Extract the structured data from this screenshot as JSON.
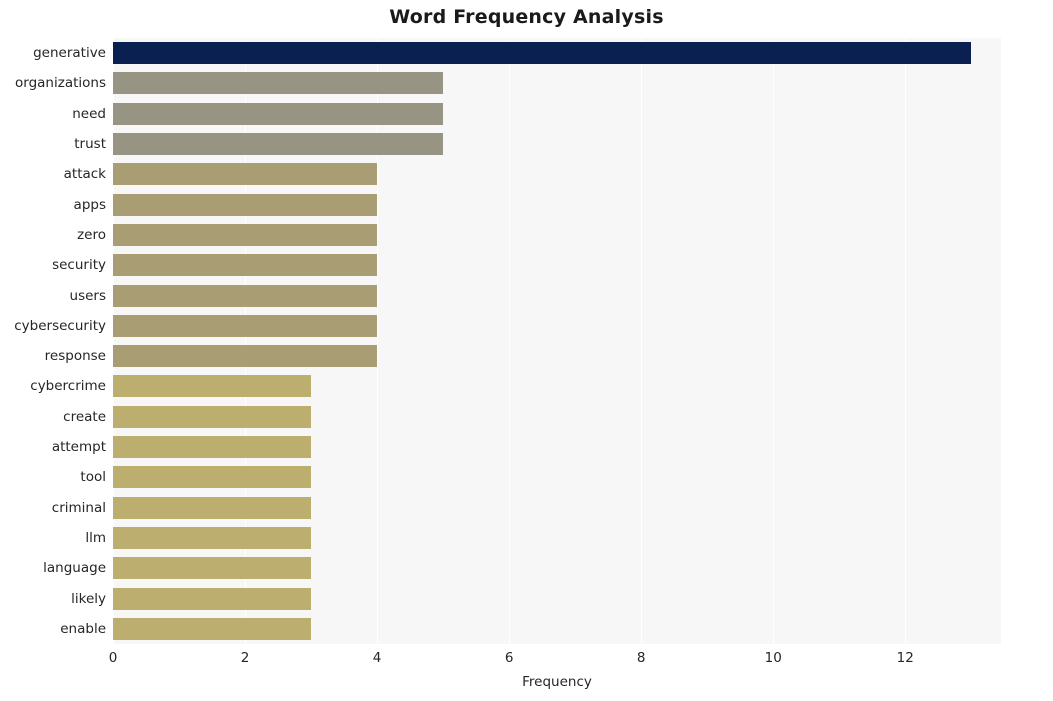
{
  "chart_data": {
    "type": "bar",
    "orientation": "horizontal",
    "title": "Word Frequency Analysis",
    "xlabel": "Frequency",
    "ylabel": "",
    "xlim": [
      0,
      13.45
    ],
    "xticks": [
      0,
      2,
      4,
      6,
      8,
      10,
      12
    ],
    "grid": true,
    "legend": null,
    "categories": [
      "generative",
      "organizations",
      "need",
      "trust",
      "attack",
      "apps",
      "zero",
      "security",
      "users",
      "cybersecurity",
      "response",
      "cybercrime",
      "create",
      "attempt",
      "tool",
      "criminal",
      "llm",
      "language",
      "likely",
      "enable"
    ],
    "values": [
      13,
      5,
      5,
      5,
      4,
      4,
      4,
      4,
      4,
      4,
      4,
      3,
      3,
      3,
      3,
      3,
      3,
      3,
      3,
      3
    ],
    "bar_colors": [
      "#0a2050",
      "#989483",
      "#989483",
      "#989483",
      "#a89d73",
      "#a89d73",
      "#a89d73",
      "#a89d73",
      "#a89d73",
      "#a89d73",
      "#a89d73",
      "#bcae6f",
      "#bcae6f",
      "#bcae6f",
      "#bcae6f",
      "#bcae6f",
      "#bcae6f",
      "#bcae6f",
      "#bcae6f",
      "#bcae6f"
    ],
    "plot_background": "#f7f7f7",
    "grid_color": "#ffffff"
  }
}
